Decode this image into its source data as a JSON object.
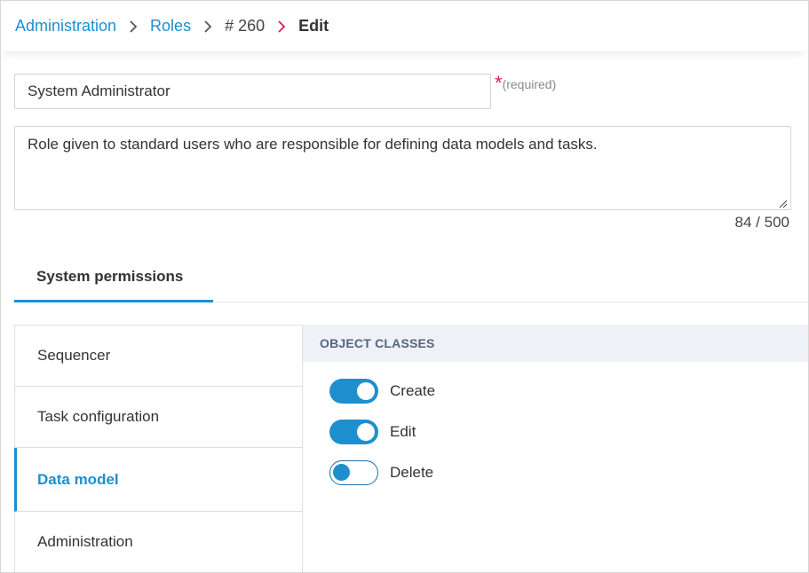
{
  "breadcrumb": {
    "administration": "Administration",
    "roles": "Roles",
    "id": "# 260",
    "current": "Edit"
  },
  "form": {
    "name_value": "System Administrator",
    "required_star": "*",
    "required_text": "(required)",
    "description_value": "Role given to standard users who are responsible for defining data models and tasks.",
    "char_counter": "84 / 500"
  },
  "tabs": [
    {
      "label": "System permissions",
      "active": true
    }
  ],
  "categories": [
    {
      "label": "Sequencer",
      "active": false
    },
    {
      "label": "Task configuration",
      "active": false
    },
    {
      "label": "Data model",
      "active": true
    },
    {
      "label": "Administration",
      "active": false
    }
  ],
  "panel": {
    "heading": "OBJECT CLASSES",
    "permissions": [
      {
        "label": "Create",
        "enabled": true
      },
      {
        "label": "Edit",
        "enabled": true
      },
      {
        "label": "Delete",
        "enabled": false
      }
    ]
  },
  "colors": {
    "accent": "#1d8fcf",
    "required": "#d81b60",
    "panel_header_bg": "#eef1f6",
    "panel_header_text": "#556480"
  }
}
